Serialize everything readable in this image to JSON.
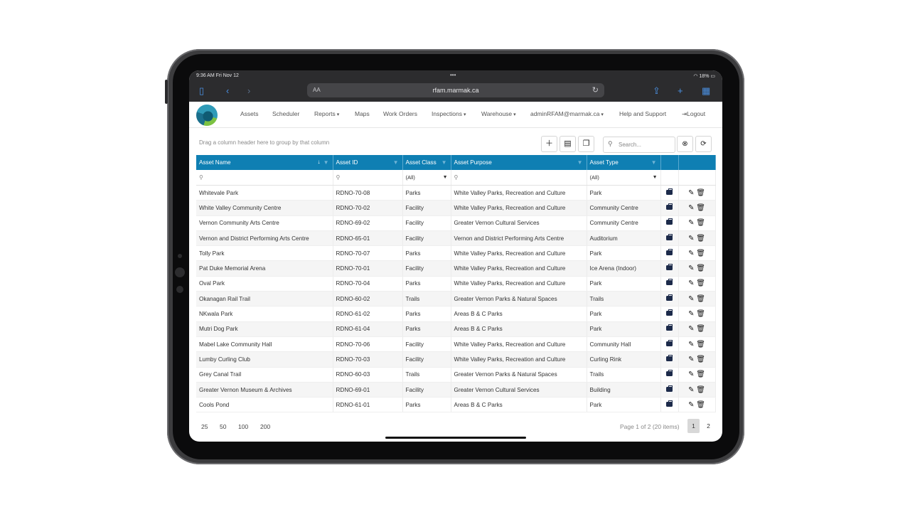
{
  "status": {
    "time": "9:36 AM  Fri Nov 12",
    "battery": "18%"
  },
  "browser": {
    "aa": "AA",
    "url": "rfam.marmak.ca"
  },
  "nav": {
    "items": [
      "Assets",
      "Scheduler",
      "Reports",
      "Maps",
      "Work Orders",
      "Inspections",
      "Warehouse",
      "adminRFAM@marmak.ca",
      "Help and Support",
      "Logout"
    ]
  },
  "grid": {
    "group_hint": "Drag a column header here to group by that column",
    "search_placeholder": "Search...",
    "columns": [
      "Asset Name",
      "Asset ID",
      "Asset Class",
      "Asset Purpose",
      "Asset Type"
    ],
    "filter_all": "(All)",
    "rows": [
      [
        "Whitevale Park",
        "RDNO-70-08",
        "Parks",
        "White Valley Parks, Recreation and Culture",
        "Park"
      ],
      [
        "White Valley Community Centre",
        "RDNO-70-02",
        "Facility",
        "White Valley Parks, Recreation and Culture",
        "Community Centre"
      ],
      [
        "Vernon Community Arts Centre",
        "RDNO-69-02",
        "Facility",
        "Greater Vernon Cultural Services",
        "Community Centre"
      ],
      [
        "Vernon and District Performing Arts Centre",
        "RDNO-65-01",
        "Facility",
        "Vernon and District Performing Arts Centre",
        "Auditorium"
      ],
      [
        "Tolly Park",
        "RDNO-70-07",
        "Parks",
        "White Valley Parks, Recreation and Culture",
        "Park"
      ],
      [
        "Pat Duke Memorial Arena",
        "RDNO-70-01",
        "Facility",
        "White Valley Parks, Recreation and Culture",
        "Ice Arena (Indoor)"
      ],
      [
        "Oval Park",
        "RDNO-70-04",
        "Parks",
        "White Valley Parks, Recreation and Culture",
        "Park"
      ],
      [
        "Okanagan Rail Trail",
        "RDNO-60-02",
        "Trails",
        "Greater Vernon Parks & Natural Spaces",
        "Trails"
      ],
      [
        "NKwala Park",
        "RDNO-61-02",
        "Parks",
        "Areas B & C Parks",
        "Park"
      ],
      [
        "Mutri Dog Park",
        "RDNO-61-04",
        "Parks",
        "Areas B & C Parks",
        "Park"
      ],
      [
        "Mabel Lake Community Hall",
        "RDNO-70-06",
        "Facility",
        "White Valley Parks, Recreation and Culture",
        "Community Hall"
      ],
      [
        "Lumby Curling Club",
        "RDNO-70-03",
        "Facility",
        "White Valley Parks, Recreation and Culture",
        "Curling Rink"
      ],
      [
        "Grey Canal Trail",
        "RDNO-60-03",
        "Trails",
        "Greater Vernon Parks & Natural Spaces",
        "Trails"
      ],
      [
        "Greater Vernon Museum & Archives",
        "RDNO-69-01",
        "Facility",
        "Greater Vernon Cultural Services",
        "Building"
      ],
      [
        "Cools Pond",
        "RDNO-61-01",
        "Parks",
        "Areas B & C Parks",
        "Park"
      ]
    ]
  },
  "pager": {
    "sizes": [
      "25",
      "50",
      "100",
      "200"
    ],
    "info": "Page 1 of 2 (20 items)",
    "pages": [
      "1",
      "2"
    ]
  }
}
